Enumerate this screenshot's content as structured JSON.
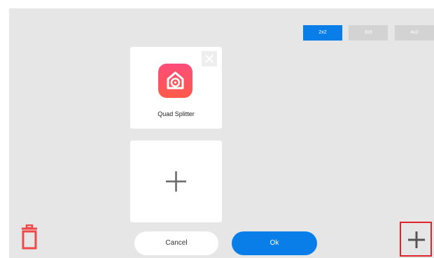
{
  "layout_tabs": [
    {
      "label": "2x2",
      "active": true
    },
    {
      "label": "3x3",
      "active": false
    },
    {
      "label": "4x2",
      "active": false
    }
  ],
  "app_card": {
    "name": "Quad Splitter",
    "icon": "home-camera-icon",
    "remove_icon": "close-icon"
  },
  "add_card": {
    "icon": "plus-icon"
  },
  "actions": {
    "cancel_label": "Cancel",
    "ok_label": "Ok"
  },
  "trash_icon": "trash-icon",
  "corner_add_icon": "plus-icon",
  "colors": {
    "accent": "#0a7ee8",
    "danger": "#e0222a",
    "app_icon_top": "#ff4c7b",
    "app_icon_bottom": "#ff5a4a"
  }
}
